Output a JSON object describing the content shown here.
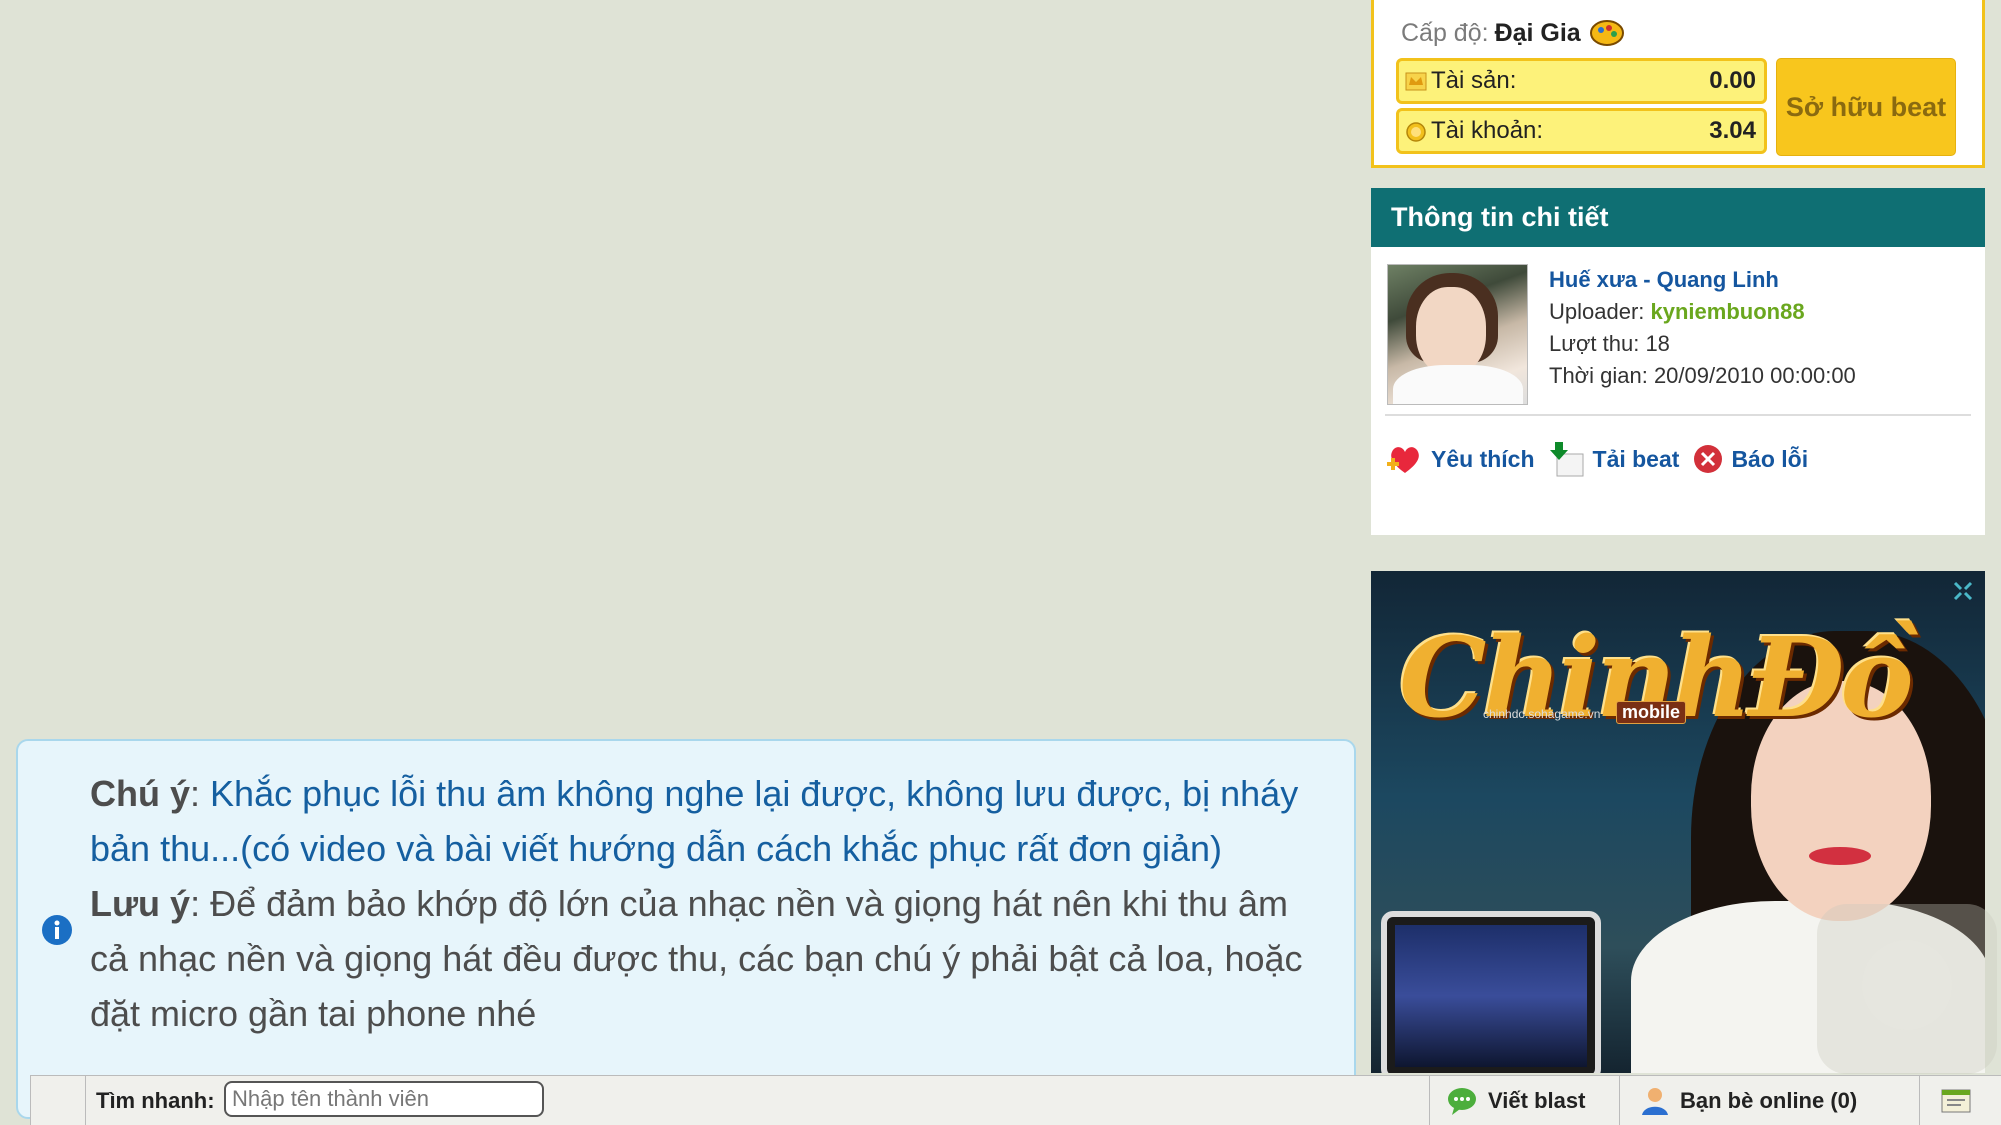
{
  "account": {
    "level_label": "Cấp độ:",
    "level_value": "Đại Gia",
    "assets_label": "Tài sản:",
    "assets_value": "0.00",
    "balance_label": "Tài khoản:",
    "balance_value": "3.04",
    "own_beat_button": "Sở hữu beat"
  },
  "detail": {
    "header": "Thông tin chi tiết",
    "song_title": "Huế xưa - Quang Linh",
    "uploader_label": "Uploader:",
    "uploader_name": "kyniembuon88",
    "recordings_label": "Lượt thu:",
    "recordings_value": "18",
    "time_label": "Thời gian:",
    "time_value": "20/09/2010 00:00:00",
    "actions": {
      "favorite": "Yêu thích",
      "download": "Tải beat",
      "report": "Báo lỗi"
    }
  },
  "ad": {
    "logo": "ChinhĐồ",
    "site": "chinhdo.sohagame.vn",
    "tag": "mobile"
  },
  "notice": {
    "note1_keyword": "Chú ý",
    "note1_text": "Khắc phục lỗi thu âm không nghe lại được, không lưu được, bị nháy bản thu...(có video và bài viết hướng dẫn cách khắc phục rất đơn giản)",
    "note2_keyword": "Lưu ý",
    "note2_text": "Để đảm bảo khớp độ lớn của nhạc nền và giọng hát nên khi thu âm cả nhạc nền và giọng hát đều được thu, các bạn chú ý phải bật cả loa, hoặc đặt micro gần tai phone nhé"
  },
  "bottom_bar": {
    "quick_search_label": "Tìm nhanh:",
    "quick_search_placeholder": "Nhập tên thành viên",
    "write_blast": "Viết blast",
    "friends_online": "Bạn bè online (0)"
  },
  "colors": {
    "teal_header": "#0f6f73",
    "gold": "#f8c61d",
    "link_blue": "#15569f",
    "uploader_green": "#6aa71e"
  }
}
